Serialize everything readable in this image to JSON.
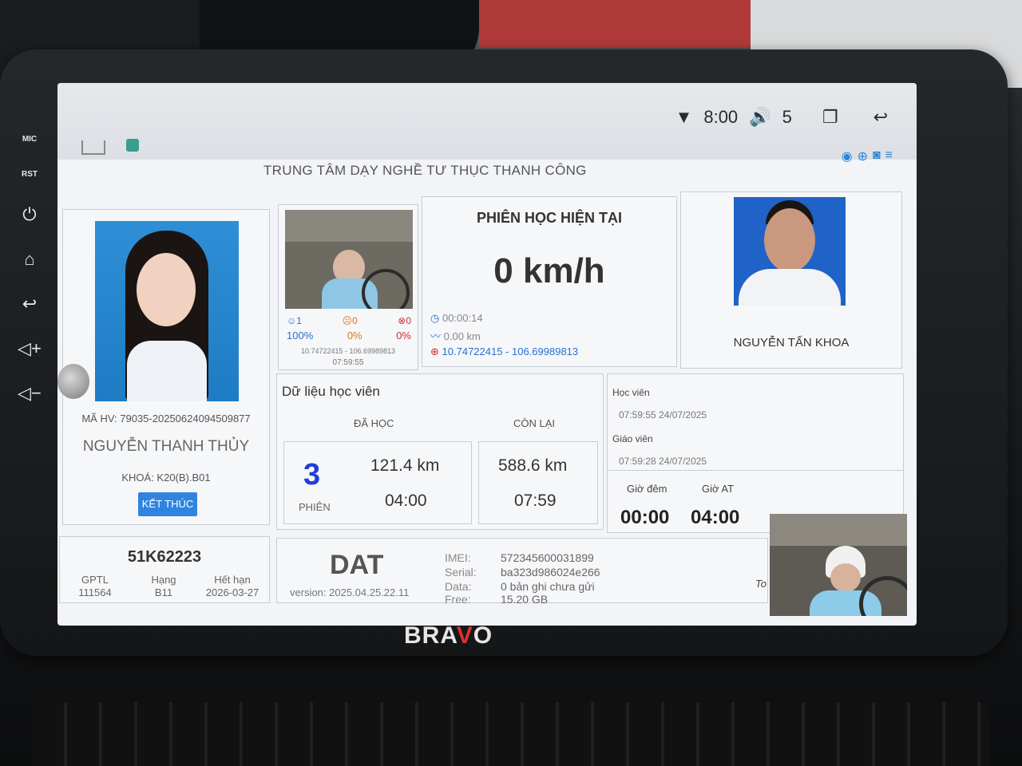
{
  "device": {
    "brand_prefix": "BRA",
    "brand_v": "V",
    "brand_suffix": "O",
    "mic_label": "MIC",
    "rst_label": "RST"
  },
  "statusbar": {
    "time": "8:00",
    "volume": "5"
  },
  "app": {
    "title": "TRUNG TÂM DẠY NGHỀ TƯ THỤC THANH CÔNG"
  },
  "student": {
    "code": "MÃ HV: 79035-20250624094509877",
    "name": "NGUYỄN THANH THỦY",
    "course": "KHOÁ: K20(B).B01",
    "end_button": "KẾT THÚC"
  },
  "camera_panel": {
    "stat_1": "1",
    "stat_2": "0",
    "stat_3": "0",
    "pct_1": "100%",
    "pct_2": "0%",
    "pct_3": "0%",
    "coord": "10.74722415 - 106.69989813",
    "time": "07:59:55"
  },
  "session": {
    "heading": "PHIÊN HỌC HIỆN TẠI",
    "speed": "0 km/h",
    "duration": "00:00:14",
    "distance": "0.00 km",
    "coordinates": "10.74722415 - 106.69989813"
  },
  "teacher": {
    "name": "NGUYỄN TẤN KHOA"
  },
  "student_data": {
    "title": "Dữ liệu học viên",
    "learned_header": "ĐÃ HỌC",
    "remaining_header": "CÒN LẠI",
    "sessions": "3",
    "sessions_label": "PHIÊN",
    "learned_km": "121.4 km",
    "learned_time": "04:00",
    "remaining_km": "588.6 km",
    "remaining_time": "07:59"
  },
  "log": {
    "student_label": "Học viên",
    "student_time": "07:59:55 24/07/2025",
    "teacher_label": "Giáo viên",
    "teacher_time": "07:59:28 24/07/2025",
    "night_label": "Giờ đêm",
    "night_value": "00:00",
    "at_label": "Giờ AT",
    "at_value": "04:00"
  },
  "vehicle": {
    "plate": "51K62223",
    "gptl_label": "GPTL",
    "gptl_value": "111564",
    "class_label": "Hạng",
    "class_value": "B11",
    "expiry_label": "Hết hạn",
    "expiry_value": "2026-03-27"
  },
  "terminal": {
    "name": "DAT",
    "version": "version: 2025.04.25.22.11",
    "imei_label": "IMEI:",
    "imei_value": "572345600031899",
    "serial_label": "Serial:",
    "serial_value": "ba323d986024e266",
    "data_label": "Data:",
    "data_value": "0 bản ghi chưa gửi",
    "free_label": "Free:",
    "free_value": "15.20 GB",
    "to_label": "To"
  },
  "colors": {
    "accent_blue": "#2f84e0",
    "session_count_blue": "#1f3fd6",
    "brand_red": "#d83030"
  }
}
